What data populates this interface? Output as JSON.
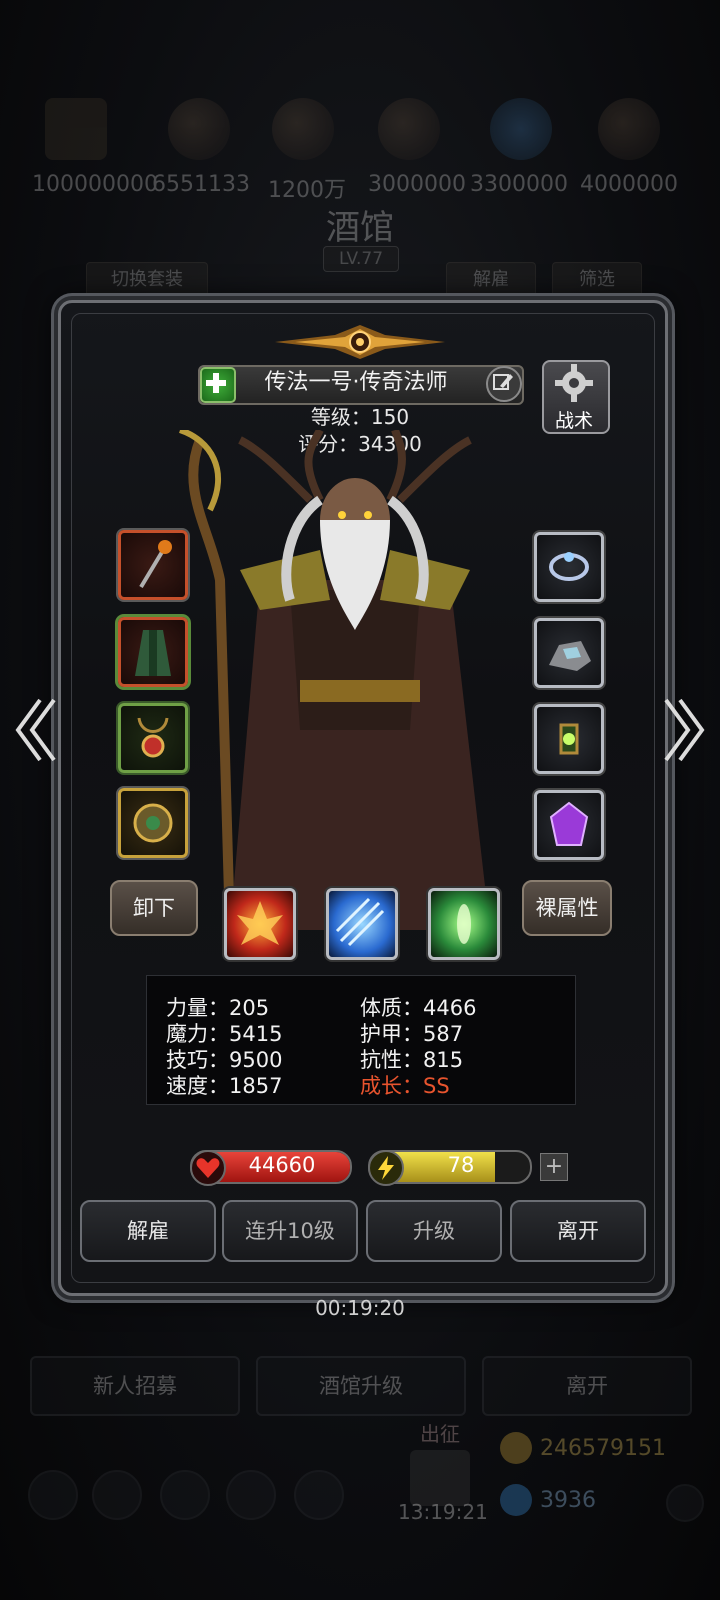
{
  "background": {
    "top_numbers": [
      "100000000",
      "6551133",
      "1200万",
      "3000000",
      "3300000",
      "4000000"
    ],
    "tavern_title": "酒馆",
    "tavern_level": "LV.77",
    "switch_outfit": "切换套装",
    "dismiss": "解雇",
    "filter": "筛选",
    "timer": "00:19:20",
    "bottom_buttons": [
      "新人招募",
      "酒馆升级",
      "离开"
    ],
    "label_outing": "出征",
    "gold": "246579151",
    "gems": "3936",
    "clock": "13:19:21"
  },
  "hero": {
    "name": "传法一号·传奇法师",
    "level": "等级：150",
    "score": "评分：34300",
    "tactic_label": "战术"
  },
  "buttons": {
    "unequip": "卸下",
    "naked_attr": "裸属性",
    "dismiss": "解雇",
    "upgrade10": "连升10级",
    "upgrade": "升级",
    "leave": "离开"
  },
  "stats": {
    "strength": "力量：205",
    "magic": "魔力：5415",
    "skill": "技巧：9500",
    "speed": "速度：1857",
    "constitution": "体质：4466",
    "armor": "护甲：587",
    "resistance": "抗性：815",
    "growth": "成长：SS"
  },
  "bars": {
    "hp": "44660",
    "energy": "78",
    "energy_fraction": 0.78
  },
  "colors": {
    "growth": "#e8542e",
    "hp_bar": "#c8221e",
    "energy_bar": "#d9c232"
  }
}
